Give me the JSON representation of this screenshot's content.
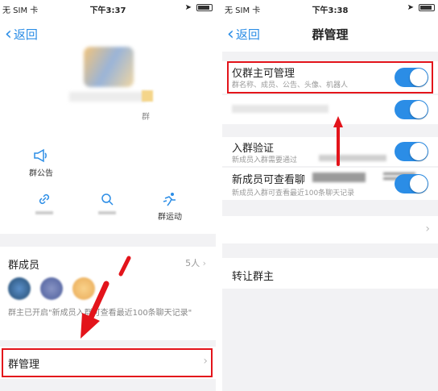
{
  "left": {
    "status": {
      "carrier": "无 SIM 卡",
      "time": "下午3:37"
    },
    "nav": {
      "back": "返回"
    },
    "profile": {
      "group_tag": "群"
    },
    "features": {
      "announcement": "群公告",
      "sport": "群运动"
    },
    "members": {
      "title": "群成员",
      "count": "5人",
      "note": "群主已开启\"新成员入群可查看最近100条聊天记录\""
    },
    "manage": {
      "label": "群管理"
    }
  },
  "right": {
    "status": {
      "carrier": "无 SIM 卡",
      "time": "下午3:38"
    },
    "nav": {
      "back": "返回",
      "title": "群管理"
    },
    "settings": [
      {
        "title": "仅群主可管理",
        "desc": "群名称、成员、公告、头像、机器人",
        "on": true
      },
      {
        "title": "",
        "desc": "",
        "on": true
      },
      {
        "title": "入群验证",
        "desc": "新成员入群需要通过",
        "on": true
      },
      {
        "title": "新成员可查看聊",
        "desc": "新成员入群可查看最近100条聊天记录",
        "on": true
      }
    ],
    "transfer": {
      "label": "转让群主"
    }
  },
  "icons": {
    "back": "chevron-left-icon",
    "announcement": "megaphone-icon",
    "link": "link-icon",
    "search": "search-icon",
    "sport": "running-icon",
    "chevron": "chevron-right-icon",
    "battery": "battery-icon",
    "location": "location-icon",
    "wifi": "wifi-icon"
  },
  "colors": {
    "accent": "#2b8de6",
    "highlight": "#e3141b"
  }
}
